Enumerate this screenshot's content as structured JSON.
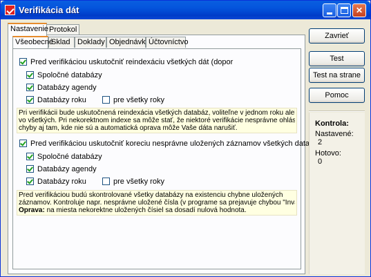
{
  "window": {
    "title": "Verifikácia dát",
    "icon": "app-check-icon"
  },
  "outer_tabs": [
    {
      "label": "Nastavenie",
      "active": true
    },
    {
      "label": "Protokol",
      "active": false
    }
  ],
  "inner_tabs": [
    {
      "label": "Všeobecné",
      "active": true
    },
    {
      "label": "Sklad",
      "active": false
    },
    {
      "label": "Doklady",
      "active": false
    },
    {
      "label": "Objednávky",
      "active": false
    },
    {
      "label": "Účtovníctvo",
      "active": false
    }
  ],
  "reindex": {
    "main_label": "Pred verifikáciou uskutočniť reindexáciu všetkých dát (dopor",
    "main_checked": true,
    "spolocne_label": "Spoločné databázy",
    "spolocne_checked": true,
    "agendy_label": "Databázy agendy",
    "agendy_checked": true,
    "roku_label": "Databázy roku",
    "roku_checked": true,
    "vsetky_roky_label": "pre všetky roky",
    "vsetky_roky_checked": false,
    "note_lines": [
      "Pri verifikácii bude uskutočnená reindexácia všetkých databáz, voliteľne v jednom roku alebo",
      "vo všetkých. Pri nekorektnom indexe sa môže stať, že niektoré verifikácie nesprávne ohlásia",
      "chyby aj tam, kde nie sú a automatická oprava môže Vaše dáta narušiť."
    ]
  },
  "correction": {
    "main_label": "Pred verifikáciou uskutočniť koreciu nesprávne uložených záznamov všetkých databáz (",
    "main_checked": true,
    "spolocne_label": "Spoločné databázy",
    "spolocne_checked": true,
    "agendy_label": "Databázy agendy",
    "agendy_checked": true,
    "roku_label": "Databázy roku",
    "roku_checked": true,
    "vsetky_roky_label": "pre všetky roky",
    "vsetky_roky_checked": false,
    "note_lines": [
      "Pred verifikáciou budú skontrolované všetky databázy na existenciu chybne uložených",
      "záznamov. Kontroluje napr. nesprávne uložené čísla (v programe sa prejavuje chybou \"Invalid"
    ],
    "note_bold": "Oprava:",
    "note_last": " na miesta nekorektne uložených čísiel sa dosadí nulová hodnota."
  },
  "buttons": {
    "close": "Zavrieť",
    "test": "Test",
    "test_page": "Test na strane",
    "help": "Pomoc"
  },
  "status": {
    "title": "Kontrola:",
    "set_label": "Nastavené:",
    "set_value": "2",
    "done_label": "Hotovo:",
    "done_value": "0"
  }
}
